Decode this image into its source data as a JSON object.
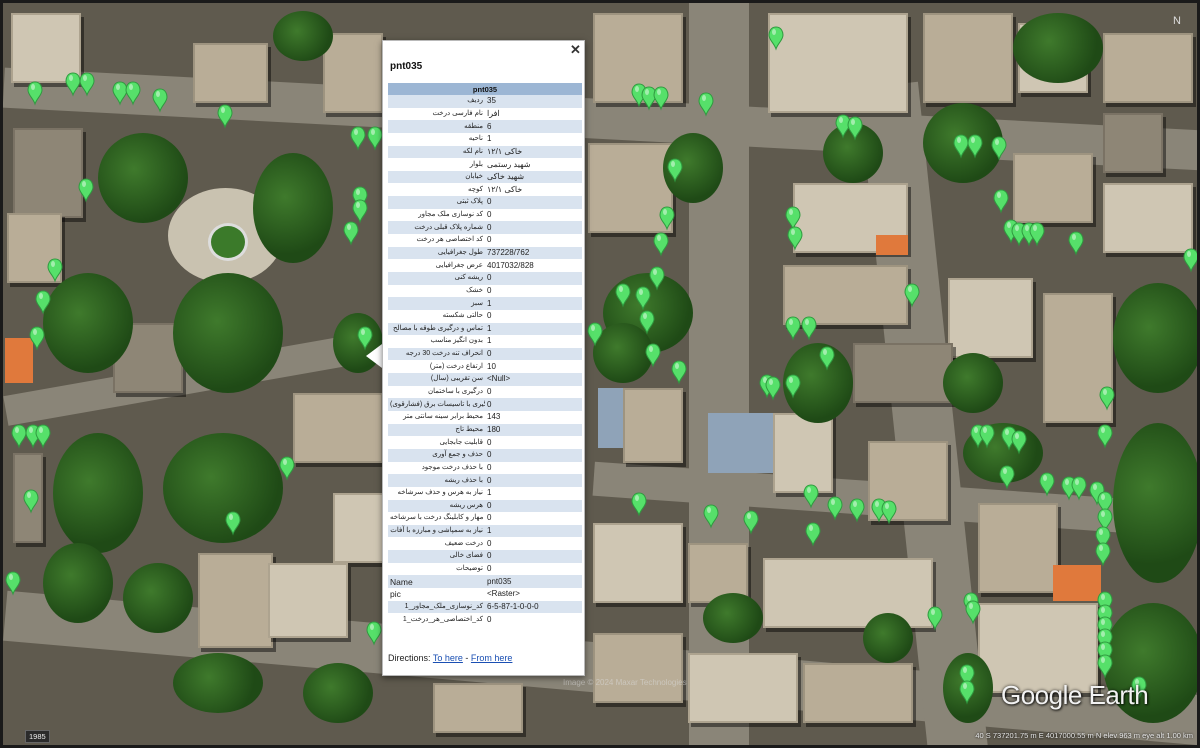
{
  "balloon": {
    "title": "pnt035",
    "table_header": "pnt035",
    "close_icon": "close-icon",
    "rows": [
      {
        "label": "ردیف",
        "value": "35"
      },
      {
        "label": "نام فارسی درخت",
        "value": "افرا"
      },
      {
        "label": "منطقه",
        "value": "6"
      },
      {
        "label": "ناحیه",
        "value": "1"
      },
      {
        "label": "نام لکه",
        "value": "خاکی ۱۲/۱"
      },
      {
        "label": "بلوار",
        "value": "شهید رستمی"
      },
      {
        "label": "خیابان",
        "value": "شهید خاکی"
      },
      {
        "label": "کوچه",
        "value": "خاکی ۱۲/۱"
      },
      {
        "label": "پلاک ثبتی",
        "value": "0"
      },
      {
        "label": "کد نوسازی ملک مجاور",
        "value": "0"
      },
      {
        "label": "شماره پلاک قبلی درخت",
        "value": "0"
      },
      {
        "label": "کد اختصاصی هر درخت",
        "value": "0"
      },
      {
        "label": "طول جغرافیایی",
        "value": "737228/762"
      },
      {
        "label": "عرض جغرافیایی",
        "value": "4017032/828"
      },
      {
        "label": "ریشه کنی",
        "value": "0"
      },
      {
        "label": "خشک",
        "value": "0"
      },
      {
        "label": "سبز",
        "value": "1"
      },
      {
        "label": "حالتی شکسته",
        "value": "0"
      },
      {
        "label": "تماس و درگیری طوقه با مصالح",
        "value": "1"
      },
      {
        "label": "بدون انگیز مناسب",
        "value": "1"
      },
      {
        "label": "انحراف تنه درخت 30 درجه",
        "value": "0"
      },
      {
        "label": "ارتفاع درخت (متر)",
        "value": "10"
      },
      {
        "label": "سن تقریبی (سال)",
        "value": "<Null>"
      },
      {
        "label": "درگیری با ساختمان",
        "value": "0"
      },
      {
        "label": "درگیری با تاسیسات برق (فشارقوی)",
        "value": "0"
      },
      {
        "label": "محیط برابر سینه سانتی متر",
        "value": "143"
      },
      {
        "label": "محیط تاج",
        "value": "180"
      },
      {
        "label": "قابلیت جابجایی",
        "value": "0"
      },
      {
        "label": "حذف و جمع آوری",
        "value": "0"
      },
      {
        "label": "با حذف درخت موجود",
        "value": "0"
      },
      {
        "label": "با حذف ریشه",
        "value": "0"
      },
      {
        "label": "نیاز به هرس و حذف سرشاخه",
        "value": "1"
      },
      {
        "label": "هرس ریشه",
        "value": "0"
      },
      {
        "label": "نیاز به مهار و کابلینگ درخت با سرشاخه",
        "value": "0"
      },
      {
        "label": "نیاز به سمپاشی و مبارزه با آفات",
        "value": "1"
      },
      {
        "label": "درخت ضعیف",
        "value": "0"
      },
      {
        "label": "فضای خالی",
        "value": "0"
      },
      {
        "label": "توضیحات",
        "value": "0"
      },
      {
        "label": "Name",
        "value": "pnt035"
      },
      {
        "label": "pic",
        "value": "<Raster>"
      },
      {
        "label": "کد_نوسازی_ملک_مجاور_1",
        "value": "6-5-87-1-0-0-0"
      },
      {
        "label": "کد_اختصاصی_هر_درخت_1",
        "value": "0"
      }
    ],
    "directions_label": "Directions:",
    "to_here": "To here",
    "separator": "-",
    "from_here": "From here"
  },
  "overlay": {
    "logo": "Google Earth",
    "status": "40 S 737201.75 m E 4017000.55 m N   elev  963 m   eye alt  1.00 km",
    "year": "1985",
    "compass_label": "N",
    "watermark": "Image © 2024 Maxar Technologies"
  },
  "colors": {
    "pin": "#56e06a",
    "pin_dark": "#2f9a3f",
    "table_header": "#9cb6d4",
    "alt_row": "#d9e3ef",
    "link": "#1a4fb3"
  },
  "icons": {
    "placemark": "green-placemark-icon",
    "close": "close-icon",
    "compass": "compass-icon"
  }
}
